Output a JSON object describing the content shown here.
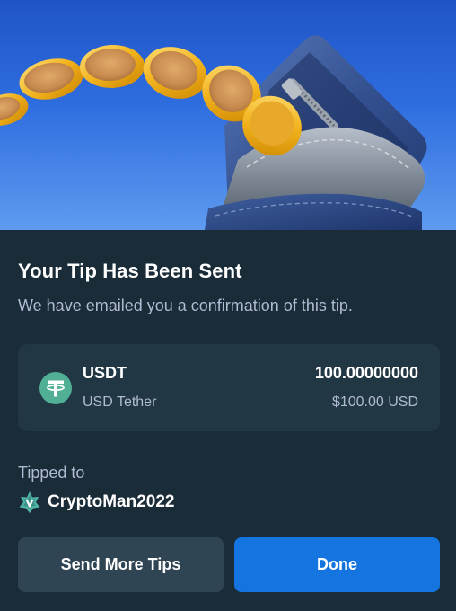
{
  "header": {
    "title": "Your Tip Has Been Sent",
    "subtitle": "We have emailed you a confirmation of this tip."
  },
  "currency": {
    "symbol": "USDT",
    "name": "USD Tether",
    "amount": "100.00000000",
    "usd_value": "$100.00 USD",
    "icon": "tether-icon",
    "icon_color": "#50af95"
  },
  "recipient": {
    "label": "Tipped to",
    "username": "CryptoMan2022",
    "badge_icon": "vip-star-icon",
    "badge_color": "#4fb3a7"
  },
  "actions": {
    "send_more_label": "Send More Tips",
    "done_label": "Done"
  },
  "colors": {
    "background": "#1a2c38",
    "card": "#213743",
    "secondary_button": "#2f4553",
    "primary_button": "#1475e1",
    "muted_text": "#b1bad3"
  }
}
